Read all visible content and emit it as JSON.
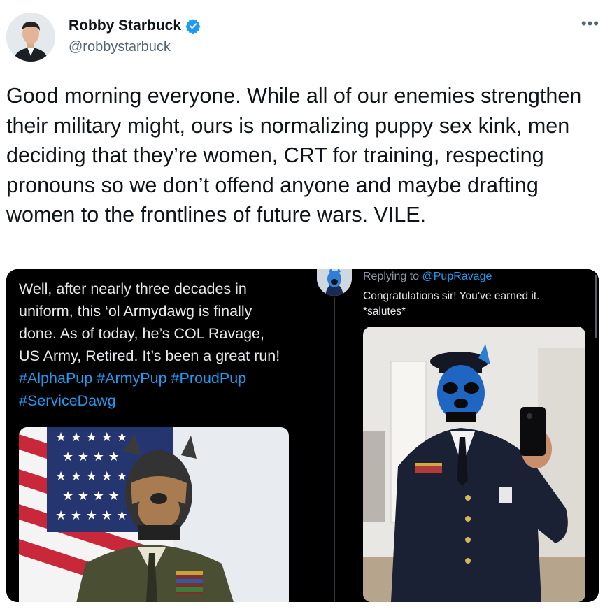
{
  "tweet": {
    "author_name": "Robby Starbuck",
    "handle": "@robbystarbuck",
    "verified": true,
    "more_icon": "more-horizontal-icon",
    "text": "Good morning everyone. While all of our enemies strengthen their military might, ours is normalizing puppy sex kink, men deciding that they’re women, CRT for training, respecting pronouns so we don’t offend anyone and maybe drafting women to the frontlines of future wars. VILE."
  },
  "media": {
    "left": {
      "caption_text": "Well, after nearly three decades in uniform, this ‘ol Armydawg is finally done. As of today, he’s COL Ravage, US Army, Retired. It’s been a great run! ",
      "hashtags": [
        "#AlphaPup",
        "#ArmyPup",
        "#ProudPup",
        "#ServiceDawg"
      ]
    },
    "right": {
      "replying_to_label": "Replying to",
      "replying_to_handle": "@PupRavage",
      "reply_text": "Congratulations sir! You’ve earned it.\n*salutes*"
    }
  },
  "colors": {
    "link": "#1d9bf0",
    "verified": "#1d9bf0",
    "text": "#0f1419",
    "secondary": "#536471"
  }
}
